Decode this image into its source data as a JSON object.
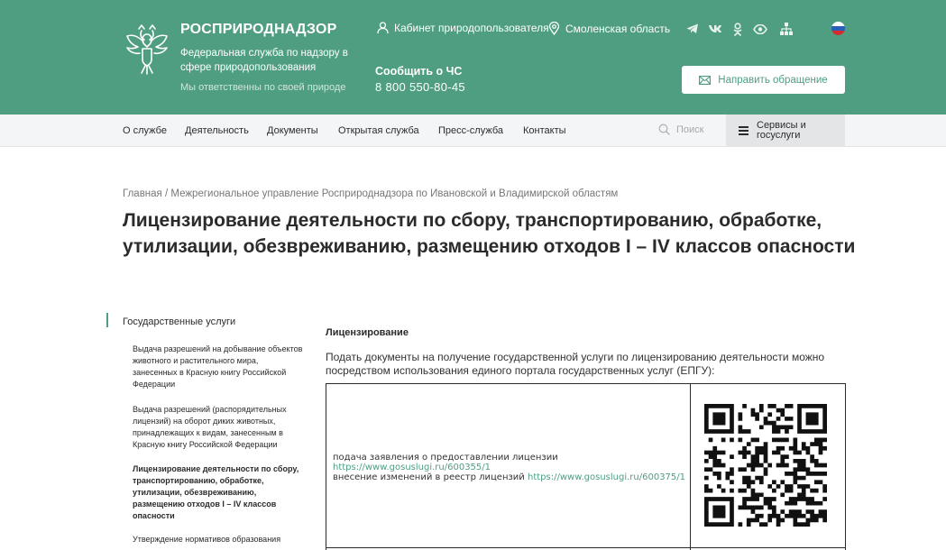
{
  "header": {
    "brand_title": "РОСПРИРОДНАДЗОР",
    "brand_subtitle": "Федеральная служба по надзору в сфере природопользования",
    "slogan": "Мы ответственны по своей природе",
    "cabinet_link": "Кабинет природопользователя",
    "region_link": "Смоленская область",
    "emergency_label": "Сообщить о ЧС",
    "emergency_phone": "8 800 550-80-45",
    "appeal_button": "Направить обращение",
    "socials": [
      "telegram-icon",
      "vk-icon",
      "odnoklassniki-icon",
      "accessibility-eye-icon"
    ],
    "accent_color": "#4f9e82"
  },
  "nav": {
    "items": [
      "О службе",
      "Деятельность",
      "Документы",
      "Открытая служба",
      "Пресс-служба",
      "Контакты"
    ],
    "search_placeholder": "Поиск",
    "services_label": "Сервисы и госуслуги"
  },
  "breadcrumb": {
    "home": "Главная",
    "separator": " / ",
    "current": "Межрегиональное управление Росприроднадзора по Ивановской и Владимирской областям"
  },
  "page_title": "Лицензирование деятельности по сбору, транспортированию, обработке, утилизации, обезвреживанию, размещению отходов I – IV классов опасности",
  "sidebar": {
    "section": "Государственные услуги",
    "items": [
      "Выдача разрешений на добывание объектов животного и растительного мира, занесенных в Красную книгу Российской Федерации",
      "Выдача разрешений (распорядительных лицензий) на оборот диких животных, принадлежащих к видам, занесенным в Красную книгу Российской Федерации",
      "Лицензирование деятельности по сбору, транспортированию, обработке, утилизации, обезвреживанию, размещению отходов I – IV классов опасности",
      "Утверждение нормативов образования"
    ],
    "active_index": 2
  },
  "main": {
    "heading": "Лицензирование",
    "intro": "Подать документы на получение государственной услуги по лицензированию деятельности можно посредством использования единого портала государственных услуг (ЕПГУ):",
    "table": {
      "line1": "подача заявления о предоставлении лицензии",
      "link1": "https://www.gosuslugi.ru/600355/1",
      "line2": "внесение изменений в реестр лицензий",
      "link2": "https://www.gosuslugi.ru/600375/1",
      "qr_icon": "qr-code-icon"
    }
  }
}
